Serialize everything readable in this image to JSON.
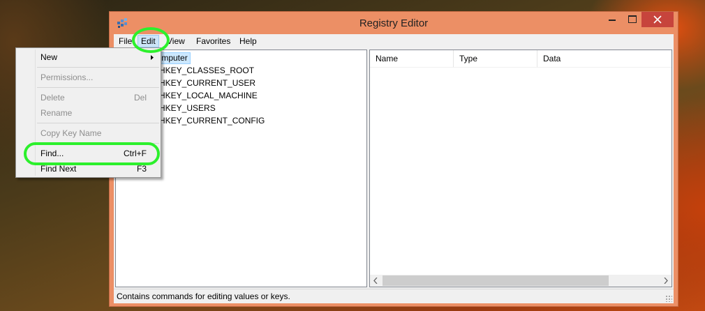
{
  "window": {
    "title": "Registry Editor",
    "icon": "registry-editor-icon",
    "controls": {
      "minimize": "minimize-icon",
      "maximize": "maximize-icon",
      "close": "close-icon"
    }
  },
  "menubar": {
    "file": "File",
    "edit": "Edit",
    "view": "View",
    "favorites": "Favorites",
    "help": "Help"
  },
  "tree": {
    "root": "Computer",
    "items": [
      "HKEY_CLASSES_ROOT",
      "HKEY_CURRENT_USER",
      "HKEY_LOCAL_MACHINE",
      "HKEY_USERS",
      "HKEY_CURRENT_CONFIG"
    ]
  },
  "list": {
    "columns": [
      "Name",
      "Type",
      "Data"
    ]
  },
  "status": "Contains commands for editing values or keys.",
  "edit_menu": {
    "new": "New",
    "permissions": "Permissions...",
    "delete": "Delete",
    "delete_shortcut": "Del",
    "rename": "Rename",
    "copy_key_name": "Copy Key Name",
    "find": "Find...",
    "find_shortcut": "Ctrl+F",
    "find_next": "Find Next",
    "find_next_shortcut": "F3"
  },
  "colors": {
    "title_bar": "#ec8f65",
    "close_button": "#c7443c",
    "highlight_callout": "#2cf02c",
    "selection": "#cce8ff"
  }
}
